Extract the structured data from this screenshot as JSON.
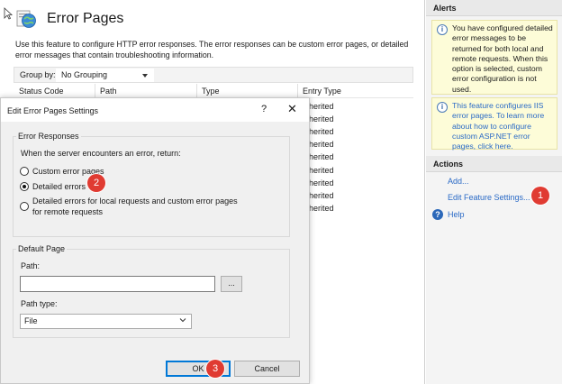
{
  "page": {
    "title": "Error Pages",
    "description": "Use this feature to configure HTTP error responses. The error responses can be custom error pages, or detailed error messages that contain troubleshooting information.",
    "group_by_label": "Group by:",
    "group_by_value": "No Grouping",
    "columns": [
      "Status Code",
      "Path",
      "Type",
      "Entry Type"
    ],
    "entry_type_values": [
      "herited",
      "herited",
      "herited",
      "herited",
      "herited",
      "herited",
      "herited",
      "herited",
      "herited"
    ]
  },
  "alerts": {
    "header": "Alerts",
    "items": [
      {
        "text": "You have configured detailed error messages to be returned for both local and remote requests. When this option is selected, custom error configuration is not used."
      },
      {
        "text": "This feature configures IIS error pages. To learn more about how to configure custom ASP.NET error pages, click here."
      }
    ]
  },
  "actions": {
    "header": "Actions",
    "add": "Add...",
    "edit_feature_settings": "Edit Feature Settings...",
    "help": "Help"
  },
  "dialog": {
    "title": "Edit Error Pages Settings",
    "help_glyph": "?",
    "close_glyph": "✕",
    "error_responses": {
      "legend": "Error Responses",
      "prompt": "When the server encounters an error, return:",
      "options": [
        "Custom error pages",
        "Detailed errors",
        "Detailed errors for local requests and custom error pages for remote requests"
      ],
      "selected": "Detailed errors"
    },
    "default_page": {
      "legend": "Default Page",
      "path_label": "Path:",
      "path_value": "",
      "browse_label": "...",
      "path_type_label": "Path type:",
      "path_type_value": "File"
    },
    "ok_label": "OK",
    "cancel_label": "Cancel"
  },
  "callouts": [
    "1",
    "2",
    "3"
  ],
  "colors": {
    "callout": "#e03b32",
    "link": "#2a6ac6",
    "alert_background": "#fdfcd8"
  },
  "icons": {
    "page_icon": "globe-error-icon",
    "alert_icon": "info-icon",
    "help_icon": "help-icon"
  }
}
